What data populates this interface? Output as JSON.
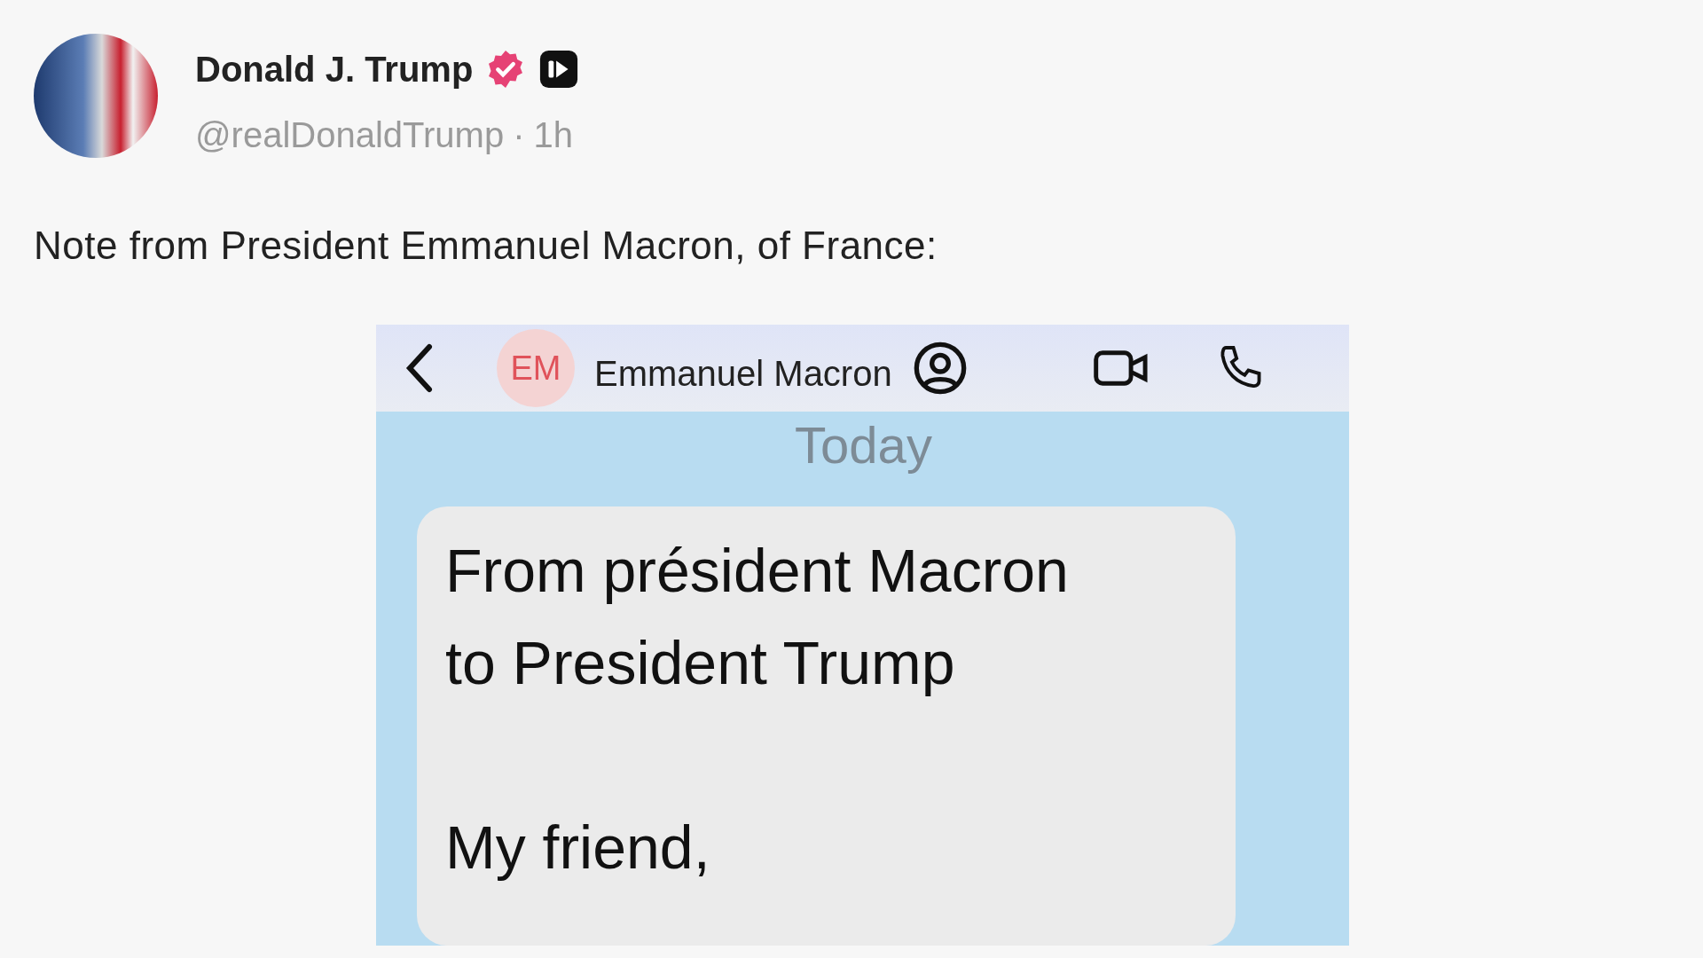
{
  "post": {
    "author": "Donald J. Trump",
    "handle": "@realDonaldTrump",
    "separator": "·",
    "time": "1h",
    "text": "Note from President Emmanuel Macron, of France:"
  },
  "attachment": {
    "header": {
      "initials": "EM",
      "contact": "Emmanuel Macron"
    },
    "date_label": "Today",
    "message": "From président Macron\nto President Trump\n\nMy friend,"
  }
}
